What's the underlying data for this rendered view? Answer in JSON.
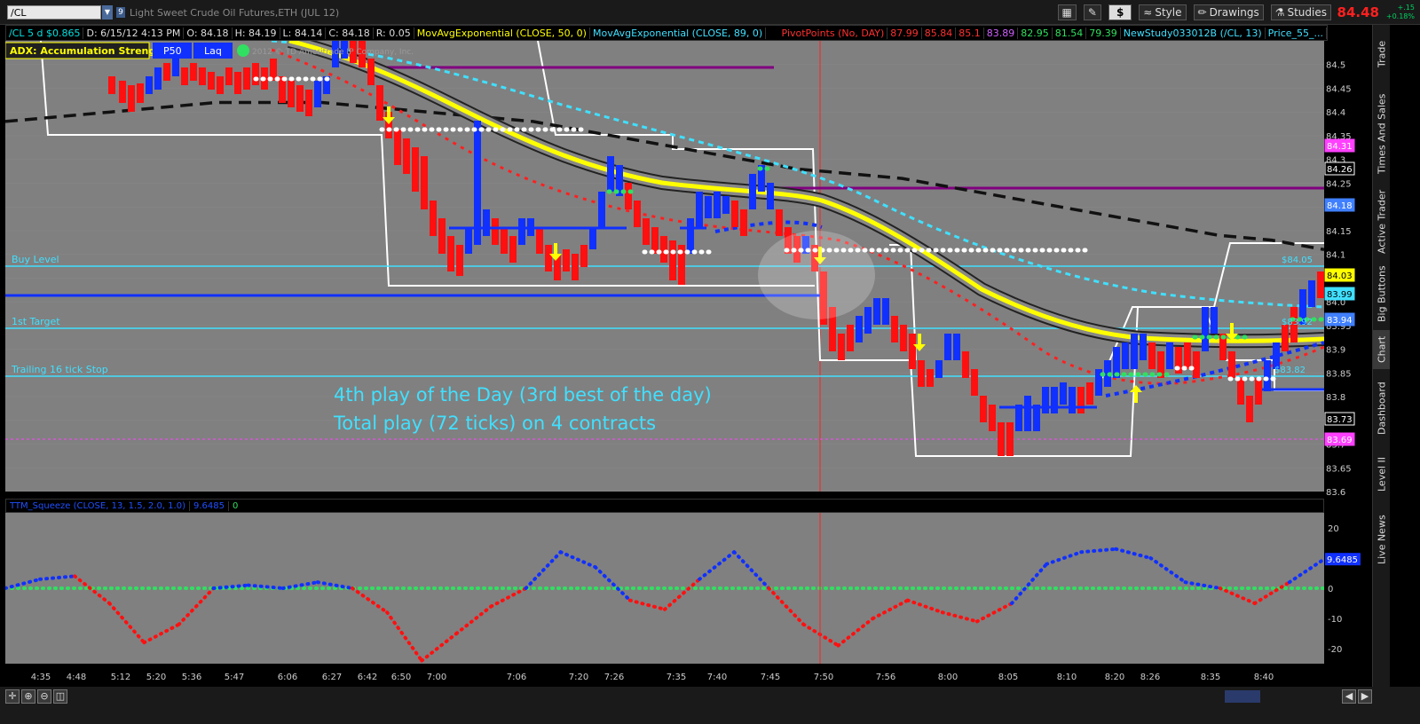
{
  "toolbar": {
    "symbol": "/CL",
    "symbol_badge": "9",
    "instrument": "Light Sweet Crude Oil Futures,ETH (JUL 12)",
    "dollar_label": "$",
    "style_label": "Style",
    "drawings_label": "Drawings",
    "studies_label": "Studies",
    "last_price": "84.48",
    "change_abs": "+.15",
    "change_pct": "+0.18%"
  },
  "info": {
    "summary": "/CL 5 d $0.865",
    "date": "D: 6/15/12 4:13 PM",
    "open": "O: 84.18",
    "high": "H: 84.19",
    "low": "L: 84.14",
    "close": "C: 84.18",
    "range": "R: 0.05",
    "ema50": "MovAvgExponential (CLOSE, 50, 0)",
    "ema89": "MovAvgExponential (CLOSE, 89, 0)",
    "pivot_label": "PivotPoints (No, DAY)",
    "pivots": [
      {
        "v": "87.99",
        "color": "#ff3030"
      },
      {
        "v": "85.84",
        "color": "#ff3030"
      },
      {
        "v": "85.1",
        "color": "#ff3030"
      },
      {
        "v": "83.89",
        "color": "#d060ff"
      },
      {
        "v": "82.95",
        "color": "#30e060"
      },
      {
        "v": "81.54",
        "color": "#30e060"
      },
      {
        "v": "79.39",
        "color": "#30e060"
      }
    ],
    "newstudy": "NewStudy033012B (/CL, 13)",
    "price_study": "Price_55_..."
  },
  "legend": {
    "adx": "ADX:  Accumulation Strength",
    "p50": "P50",
    "laq": "Laq",
    "copyright": "2012 © TD Ameritrade IP Company, Inc."
  },
  "annotations": {
    "buy_level": "Buy Level",
    "first_target": "1st Target",
    "trailing_stop": "Trailing 16 tick Stop",
    "note_line1": "4th play of the Day (3rd best of the day)",
    "note_line2": "Total play (72 ticks) on 4 contracts",
    "price_tag_1": "$84.05",
    "price_tag_2": "$83.92",
    "price_tag_3": "$83.82"
  },
  "lower": {
    "title": "TTM_Squeeze (CLOSE, 13, 1.5, 2.0, 1.0)",
    "value": "9.6485",
    "zero": "0"
  },
  "sidebar": {
    "tabs": [
      "Trade",
      "Times And Sales",
      "Active Trader",
      "Big Buttons",
      "Chart",
      "Dashboard",
      "Level II",
      "Live News"
    ]
  },
  "chart_data": [
    {
      "type": "candlestick",
      "ylim": [
        83.6,
        84.55
      ],
      "y_ticks": [
        "84.5",
        "84.45",
        "84.4",
        "84.35",
        "84.3",
        "84.25",
        "84.2",
        "84.15",
        "84.1",
        "84.05",
        "84.0",
        "83.95",
        "83.9",
        "83.85",
        "83.8",
        "83.75",
        "83.7",
        "83.65",
        "83.6"
      ],
      "x_ticks": [
        "4:35",
        "4:48",
        "5:12",
        "5:20",
        "5:36",
        "5:47",
        "6:06",
        "6:27",
        "6:42",
        "6:50",
        "7:00",
        "7:06",
        "7:20",
        "7:26",
        "7:35",
        "7:40",
        "7:45",
        "7:50",
        "7:56",
        "8:00",
        "8:05",
        "8:10",
        "8:20",
        "8:26",
        "8:35",
        "8:40"
      ],
      "price_labels": [
        {
          "value": "84.31",
          "color": "#ff40ff"
        },
        {
          "value": "84.26",
          "color": "#ffffff"
        },
        {
          "value": "84.18",
          "color": "#4080ff"
        },
        {
          "value": "84.03",
          "color": "#ffff00"
        },
        {
          "value": "83.99",
          "color": "#40e0ff"
        },
        {
          "value": "83.94",
          "color": "#4080ff"
        },
        {
          "value": "83.73",
          "color": "#ffffff"
        },
        {
          "value": "83.69",
          "color": "#ff40ff"
        }
      ],
      "levels": {
        "buy_level": 84.04,
        "first_target": 83.92,
        "trailing_stop": 83.83
      },
      "series": [
        {
          "name": "MovAvgExponential (CLOSE, 50, 0)",
          "values": [
            84.54,
            84.53,
            84.51,
            84.48,
            84.45,
            84.42,
            84.39,
            84.36,
            84.33,
            84.31,
            84.29,
            84.27,
            84.25,
            84.23,
            84.21,
            84.19,
            84.17,
            84.14,
            84.1,
            84.05,
            84.0,
            83.96,
            83.93,
            83.91,
            83.9,
            83.89
          ]
        },
        {
          "name": "MovAvgExponential (CLOSE, 89, 0)",
          "values": [
            84.38,
            84.39,
            84.4,
            84.41,
            84.42,
            84.42,
            84.42,
            84.41,
            84.4,
            84.39,
            84.38,
            84.36,
            84.34,
            84.32,
            84.3,
            84.28,
            84.27,
            84.26,
            84.24,
            84.22,
            84.2,
            84.18,
            84.16,
            84.14,
            84.13,
            84.11
          ]
        }
      ]
    },
    {
      "type": "line",
      "title": "TTM_Squeeze (CLOSE, 13, 1.5, 2.0, 1.0)",
      "ylim": [
        -25,
        25
      ],
      "y_ticks": [
        "20",
        "10",
        "0",
        "-10",
        "-20"
      ],
      "series": [
        {
          "name": "TTM_Squeeze (CLOSE, 13, 1.5, 2.0, 1.0)",
          "values": [
            0,
            3,
            4,
            -5,
            -18,
            -12,
            0,
            1,
            0,
            2,
            0,
            -8,
            -24,
            -15,
            -6,
            0,
            12,
            7,
            -4,
            -7,
            3,
            12,
            0,
            -12,
            -19,
            -10,
            -4,
            -8,
            -11,
            -5,
            8,
            12,
            13,
            10,
            2,
            0,
            -5,
            2,
            9.6485
          ]
        }
      ]
    }
  ]
}
